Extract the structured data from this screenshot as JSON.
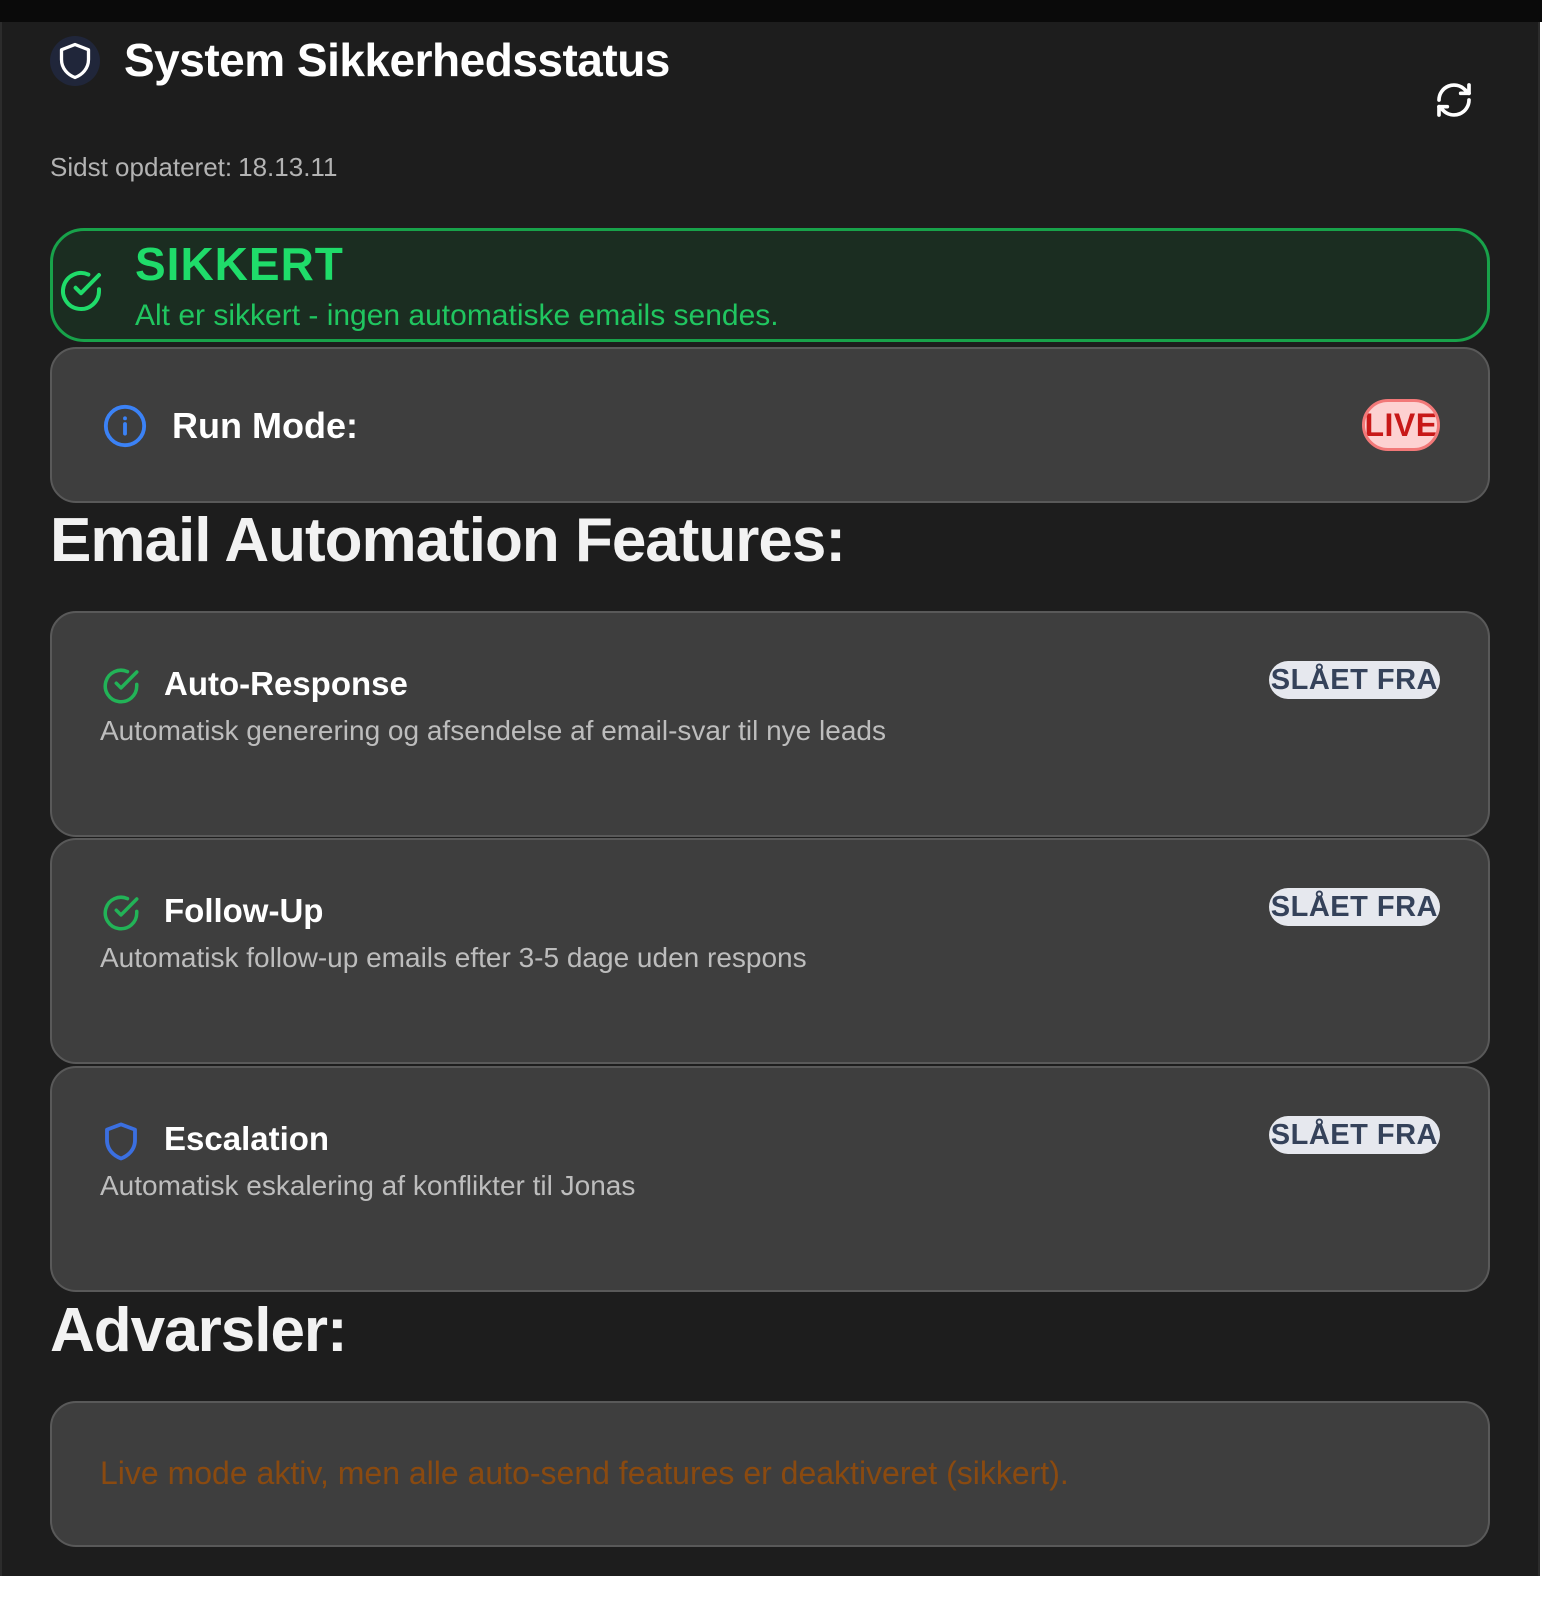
{
  "header": {
    "title": "System Sikkerhedsstatus",
    "shield_icon": "shield-icon",
    "refresh_icon": "refresh-icon",
    "last_updated_label": "Sidst opdateret:",
    "last_updated_value": "18.13.11"
  },
  "status": {
    "icon": "check-circle-icon",
    "title": "SIKKERT",
    "message": "Alt er sikkert - ingen automatiske emails sendes.",
    "color": "#1fdc6a"
  },
  "run_mode": {
    "icon": "info-icon",
    "label": "Run Mode:",
    "value": "LIVE",
    "value_color": "#c81818"
  },
  "features_heading": "Email Automation Features:",
  "features": [
    {
      "icon": "check-circle-icon",
      "title": "Auto-Response",
      "description": "Automatisk generering og afsendelse af email-svar til nye leads",
      "status": "SLÅET FRA"
    },
    {
      "icon": "check-circle-icon",
      "title": "Follow-Up",
      "description": "Automatisk follow-up emails efter 3-5 dage uden respons",
      "status": "SLÅET FRA"
    },
    {
      "icon": "shield-icon",
      "title": "Escalation",
      "description": "Automatisk eskalering af konflikter til Jonas",
      "status": "SLÅET FRA"
    }
  ],
  "warnings_heading": "Advarsler:",
  "warnings": [
    "Live mode aktiv, men alle auto-send features er deaktiveret (sikkert)."
  ]
}
